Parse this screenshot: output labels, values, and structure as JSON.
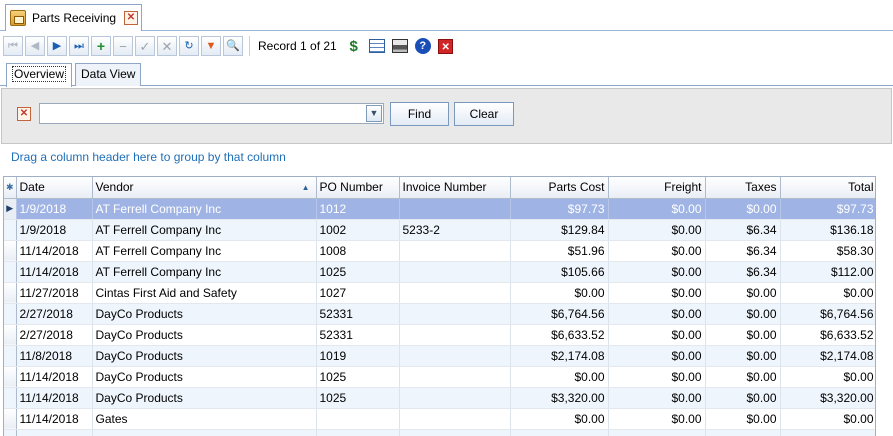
{
  "document_tab": {
    "title": "Parts Receiving",
    "icon": "parts-receiving-icon",
    "close_glyph": "✕"
  },
  "toolbar": {
    "buttons": [
      {
        "name": "first-record-button",
        "glyph": "⏮",
        "enabled": false
      },
      {
        "name": "previous-record-button",
        "glyph": "◀",
        "enabled": false
      },
      {
        "name": "next-record-button",
        "glyph": "▶",
        "enabled": true
      },
      {
        "name": "last-record-button",
        "glyph": "⏭",
        "enabled": true
      },
      {
        "name": "add-record-button",
        "glyph": "+",
        "enabled": true
      },
      {
        "name": "delete-record-button",
        "glyph": "−",
        "enabled": false
      },
      {
        "name": "save-record-button",
        "glyph": "✓",
        "enabled": false
      },
      {
        "name": "cancel-edit-button",
        "glyph": "✕",
        "enabled": false
      },
      {
        "name": "refresh-button",
        "glyph": "↻",
        "enabled": true
      },
      {
        "name": "filter-button",
        "glyph": "▼",
        "enabled": true
      },
      {
        "name": "find-button",
        "glyph": "🔍",
        "enabled": true
      }
    ],
    "record_text": "Record 1 of 21",
    "right_icons": [
      "dollar-icon",
      "grid-export-icon",
      "print-icon",
      "help-icon",
      "close-window-icon"
    ]
  },
  "view_tabs": [
    {
      "label": "Overview",
      "active": true
    },
    {
      "label": "Data View",
      "active": false
    }
  ],
  "search": {
    "value": "",
    "placeholder": "",
    "find_label": "Find",
    "clear_label": "Clear"
  },
  "group_panel": {
    "text": "Drag a column header here to group by that column"
  },
  "grid": {
    "columns": [
      {
        "key": "date",
        "label": "Date",
        "align": "left"
      },
      {
        "key": "vendor",
        "label": "Vendor",
        "align": "left",
        "sorted": "asc"
      },
      {
        "key": "po",
        "label": "PO Number",
        "align": "left"
      },
      {
        "key": "invoice",
        "label": "Invoice Number",
        "align": "left"
      },
      {
        "key": "parts",
        "label": "Parts Cost",
        "align": "right"
      },
      {
        "key": "freight",
        "label": "Freight",
        "align": "right"
      },
      {
        "key": "taxes",
        "label": "Taxes",
        "align": "right"
      },
      {
        "key": "total",
        "label": "Total",
        "align": "right"
      }
    ],
    "rows": [
      {
        "date": "1/9/2018",
        "vendor": "AT Ferrell Company Inc",
        "po": "1012",
        "invoice": "",
        "parts": "$97.73",
        "freight": "$0.00",
        "taxes": "$0.00",
        "total": "$97.73"
      },
      {
        "date": "1/9/2018",
        "vendor": "AT Ferrell Company Inc",
        "po": "1002",
        "invoice": "5233-2",
        "parts": "$129.84",
        "freight": "$0.00",
        "taxes": "$6.34",
        "total": "$136.18"
      },
      {
        "date": "11/14/2018",
        "vendor": "AT Ferrell Company Inc",
        "po": "1008",
        "invoice": "",
        "parts": "$51.96",
        "freight": "$0.00",
        "taxes": "$6.34",
        "total": "$58.30"
      },
      {
        "date": "11/14/2018",
        "vendor": "AT Ferrell Company Inc",
        "po": "1025",
        "invoice": "",
        "parts": "$105.66",
        "freight": "$0.00",
        "taxes": "$6.34",
        "total": "$112.00"
      },
      {
        "date": "11/27/2018",
        "vendor": "Cintas First Aid and Safety",
        "po": "1027",
        "invoice": "",
        "parts": "$0.00",
        "freight": "$0.00",
        "taxes": "$0.00",
        "total": "$0.00"
      },
      {
        "date": "2/27/2018",
        "vendor": "DayCo Products",
        "po": "52331",
        "invoice": "",
        "parts": "$6,764.56",
        "freight": "$0.00",
        "taxes": "$0.00",
        "total": "$6,764.56"
      },
      {
        "date": "2/27/2018",
        "vendor": "DayCo Products",
        "po": "52331",
        "invoice": "",
        "parts": "$6,633.52",
        "freight": "$0.00",
        "taxes": "$0.00",
        "total": "$6,633.52"
      },
      {
        "date": "11/8/2018",
        "vendor": "DayCo Products",
        "po": "1019",
        "invoice": "",
        "parts": "$2,174.08",
        "freight": "$0.00",
        "taxes": "$0.00",
        "total": "$2,174.08"
      },
      {
        "date": "11/14/2018",
        "vendor": "DayCo Products",
        "po": "1025",
        "invoice": "",
        "parts": "$0.00",
        "freight": "$0.00",
        "taxes": "$0.00",
        "total": "$0.00"
      },
      {
        "date": "11/14/2018",
        "vendor": "DayCo Products",
        "po": "1025",
        "invoice": "",
        "parts": "$3,320.00",
        "freight": "$0.00",
        "taxes": "$0.00",
        "total": "$3,320.00"
      },
      {
        "date": "11/14/2018",
        "vendor": "Gates",
        "po": "",
        "invoice": "",
        "parts": "$0.00",
        "freight": "$0.00",
        "taxes": "$0.00",
        "total": "$0.00"
      },
      {
        "date": "",
        "vendor": "",
        "po": "",
        "invoice": "",
        "parts": "",
        "freight": "",
        "taxes": "",
        "total": ""
      }
    ],
    "selected_row": 0,
    "row_indicator_glyph": "▶",
    "new_row_glyph": "✱"
  },
  "colors": {
    "selection": "#9fb4e4",
    "alt_row": "#eef5fc",
    "link_text": "#1f6fb8",
    "border": "#8ea7c6"
  }
}
